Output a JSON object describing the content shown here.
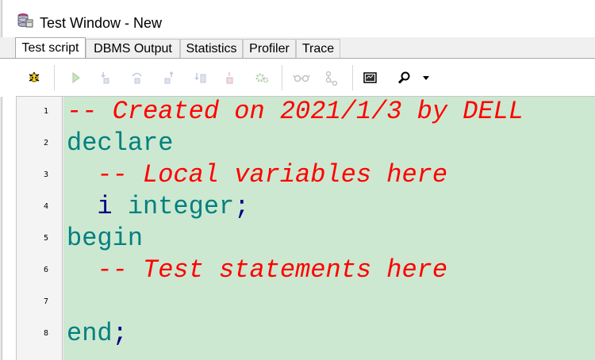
{
  "window": {
    "title": "Test Window - New",
    "icon": "database-window-icon"
  },
  "tabs": [
    {
      "label": "Test script",
      "active": true
    },
    {
      "label": "DBMS Output",
      "active": false
    },
    {
      "label": "Statistics",
      "active": false
    },
    {
      "label": "Profiler",
      "active": false
    },
    {
      "label": "Trace",
      "active": false
    }
  ],
  "toolbar": {
    "icons": [
      "debug-start-icon",
      "run-icon",
      "step-into-icon",
      "step-over-icon",
      "step-out-icon",
      "run-to-exception-icon",
      "halt-icon",
      "settings-gear-icon",
      "watch-glasses-icon",
      "breakpoints-icon",
      "screen-output-icon",
      "find-magnifier-icon",
      "dropdown-arrow-icon"
    ]
  },
  "editor": {
    "line_numbers": [
      "1",
      "2",
      "3",
      "4",
      "5",
      "6",
      "7",
      "8"
    ],
    "lines": [
      {
        "comment": "-- Created on 2021/1/3 by DELL"
      },
      {
        "keyword": "declare"
      },
      {
        "indent": "  ",
        "comment": "-- Local variables here"
      },
      {
        "indent": "  ",
        "ident": "i",
        "space": " ",
        "type": "integer",
        "punct": ";"
      },
      {
        "keyword": "begin"
      },
      {
        "indent": "  ",
        "comment": "-- Test statements here"
      },
      {},
      {
        "keyword": "end",
        "punct": ";"
      }
    ]
  },
  "colors": {
    "editor_background": "#cde8d0",
    "comment": "#ff0000",
    "keyword": "#008080",
    "identifier": "#000080"
  }
}
